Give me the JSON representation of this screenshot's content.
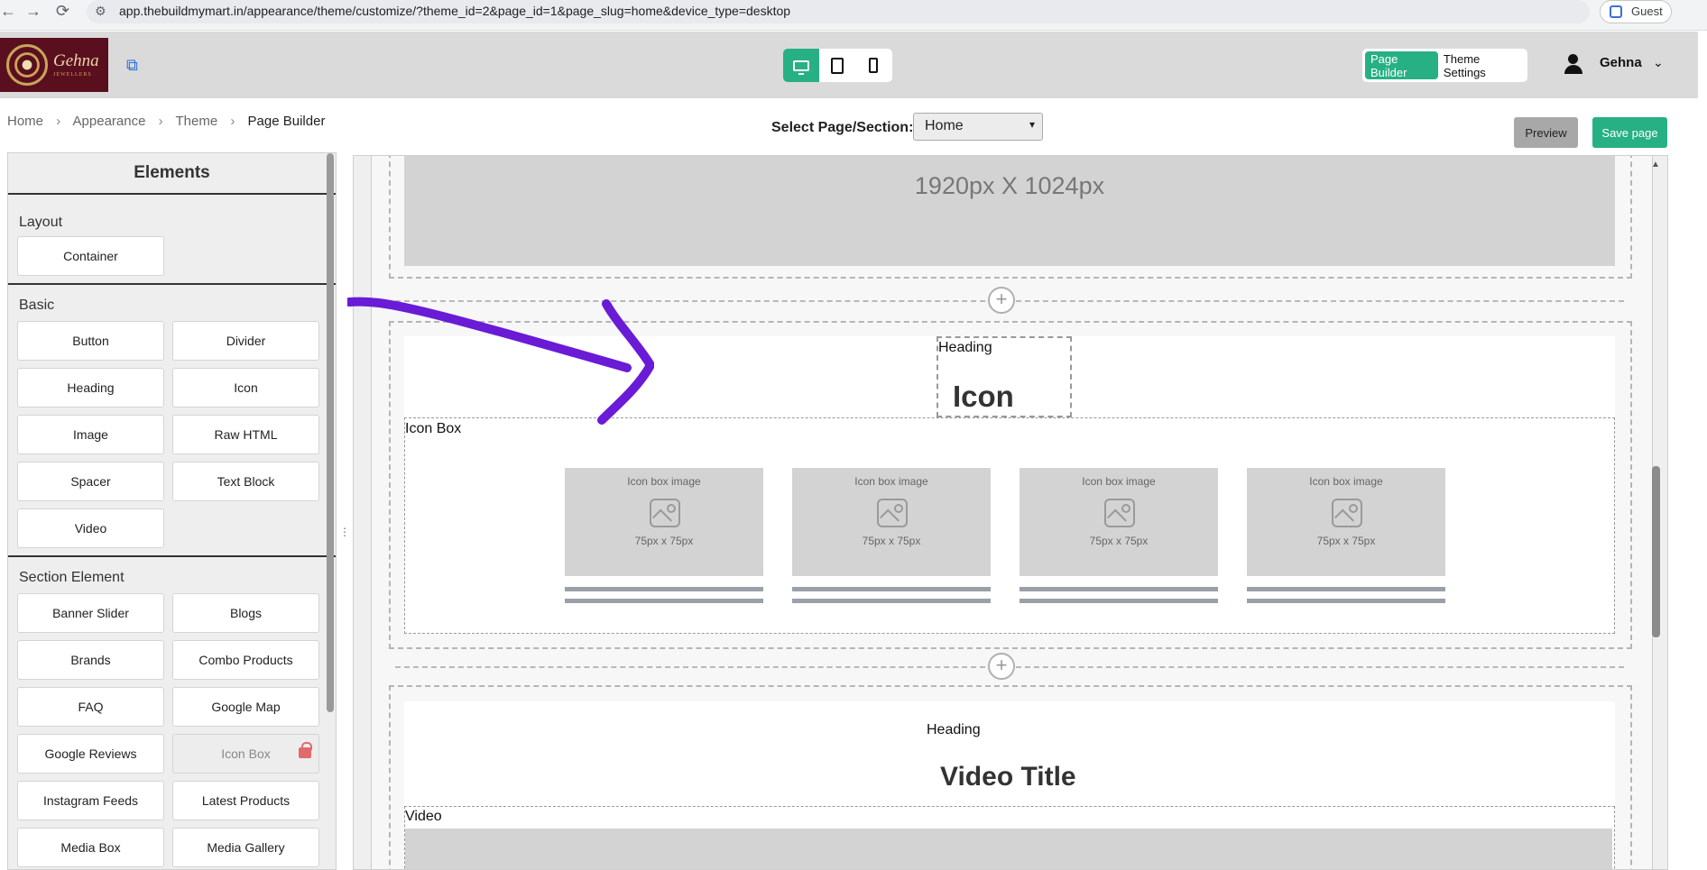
{
  "browser": {
    "back": "←",
    "forward": "→",
    "reload": "⟳",
    "url": "app.thebuildmymart.in/appearance/theme/customize/?theme_id=2&page_id=1&page_slug=home&device_type=desktop",
    "profile_label": "Guest"
  },
  "header": {
    "logo_text": "Gehna",
    "logo_subtext": "JEWELLERS",
    "external_link_icon": "external-link-icon",
    "device_modes": [
      "desktop-icon",
      "tablet-icon",
      "mobile-icon"
    ],
    "active_device": "desktop",
    "tabs": [
      {
        "label": "Page Builder",
        "active": true
      },
      {
        "label": "Theme Settings",
        "active": false
      }
    ],
    "user_name": "Gehna",
    "accent_color": "#27b084"
  },
  "breadcrumb": [
    "Home",
    "Appearance",
    "Theme",
    "Page Builder"
  ],
  "page_select": {
    "label": "Select Page/Section:",
    "value": "Home"
  },
  "actions": {
    "preview_label": "Preview",
    "save_label": "Save page"
  },
  "sidebar": {
    "title": "Elements",
    "groups": [
      {
        "name": "Layout",
        "items": [
          "Container"
        ]
      },
      {
        "name": "Basic",
        "items": [
          "Button",
          "Divider",
          "Heading",
          "Icon",
          "Image",
          "Raw HTML",
          "Spacer",
          "Text Block",
          "Video"
        ]
      },
      {
        "name": "Section Element",
        "items": [
          "Banner Slider",
          "Blogs",
          "Brands",
          "Combo Products",
          "FAQ",
          "Google Map",
          "Google Reviews",
          "Icon Box",
          "Instagram Feeds",
          "Latest Products",
          "Media Box",
          "Media Gallery"
        ]
      }
    ],
    "locked_item": "Icon Box"
  },
  "canvas": {
    "banner_size_text": "1920px X 1024px",
    "iconbox_section": {
      "heading_tag": "Heading",
      "heading_text": "Icon Box",
      "element_tag": "Icon Box",
      "cards": [
        {
          "title": "Icon box image",
          "size": "75px x 75px"
        },
        {
          "title": "Icon box image",
          "size": "75px x 75px"
        },
        {
          "title": "Icon box image",
          "size": "75px x 75px"
        },
        {
          "title": "Icon box image",
          "size": "75px x 75px"
        }
      ]
    },
    "video_section": {
      "heading_tag": "Heading",
      "heading_text": "Video Title",
      "element_tag": "Video"
    },
    "add_symbol": "+"
  },
  "annotation": {
    "color": "#6a1bd6"
  }
}
